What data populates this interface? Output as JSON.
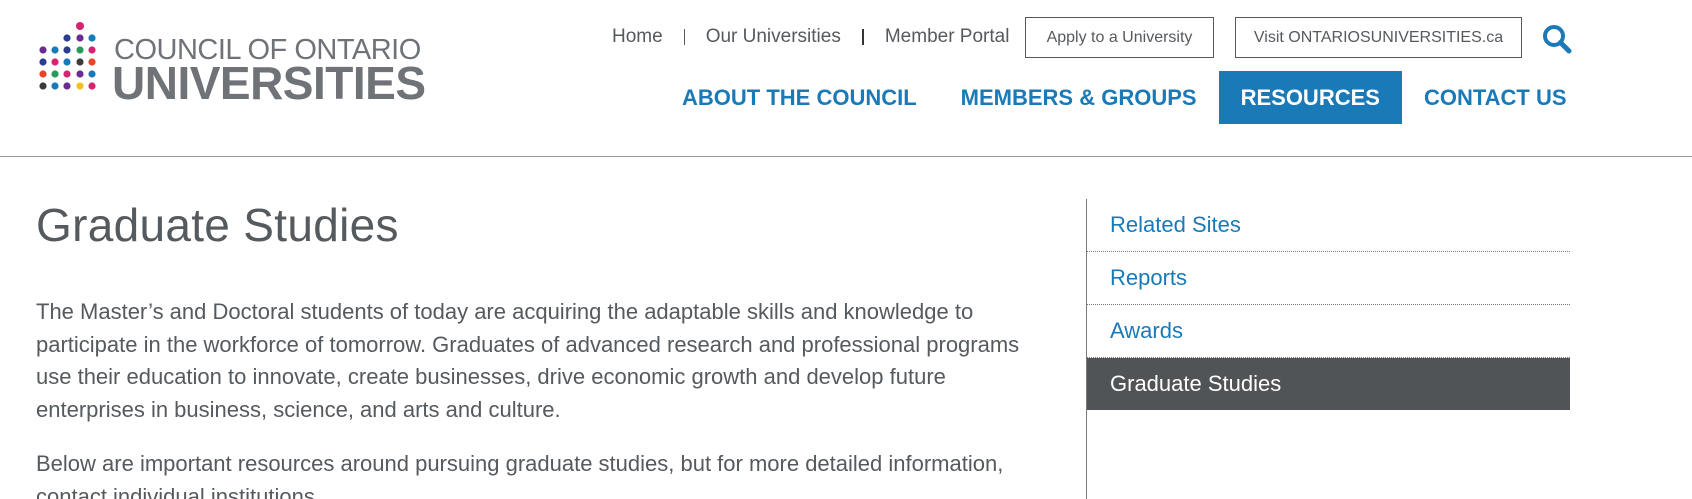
{
  "logo": {
    "line1": "COUNCIL OF ONTARIO",
    "line2": "UNIVERSITIES",
    "dot_colors": [
      "#6b2c8f",
      "#1a7ab8",
      "#d6246e",
      "#2b3e8c",
      "#e8442a",
      "#f4c020",
      "#2a9a5a",
      "#3b3b3b"
    ]
  },
  "util_nav": {
    "items": [
      "Home",
      "Our Universities",
      "Member Portal"
    ]
  },
  "buttons": {
    "apply": "Apply to a University",
    "visit": "Visit ONTARIOSUNIVERSITIES.ca"
  },
  "main_nav": {
    "items": [
      {
        "label": "ABOUT THE COUNCIL",
        "active": false
      },
      {
        "label": "MEMBERS & GROUPS",
        "active": false
      },
      {
        "label": "RESOURCES",
        "active": true
      },
      {
        "label": "CONTACT US",
        "active": false
      }
    ]
  },
  "page": {
    "title": "Graduate Studies",
    "paragraphs": [
      "The Master’s and Doctoral students of today are acquiring the adaptable skills and knowledge to participate in the workforce of tomorrow. Graduates of advanced research and professional programs use their education to innovate, create businesses, drive economic growth and develop future enterprises in business, science, and arts and culture.",
      "Below are important resources around pursuing graduate studies, but for more detailed information, contact individual institutions."
    ]
  },
  "sidebar": {
    "items": [
      {
        "label": "Related Sites",
        "active": false
      },
      {
        "label": "Reports",
        "active": false
      },
      {
        "label": "Awards",
        "active": false
      },
      {
        "label": "Graduate Studies",
        "active": true
      }
    ]
  },
  "colors": {
    "accent": "#1a7ab8",
    "text": "#555a5e",
    "sidebar_active": "#505456"
  },
  "icons": {
    "search": "search-icon"
  }
}
